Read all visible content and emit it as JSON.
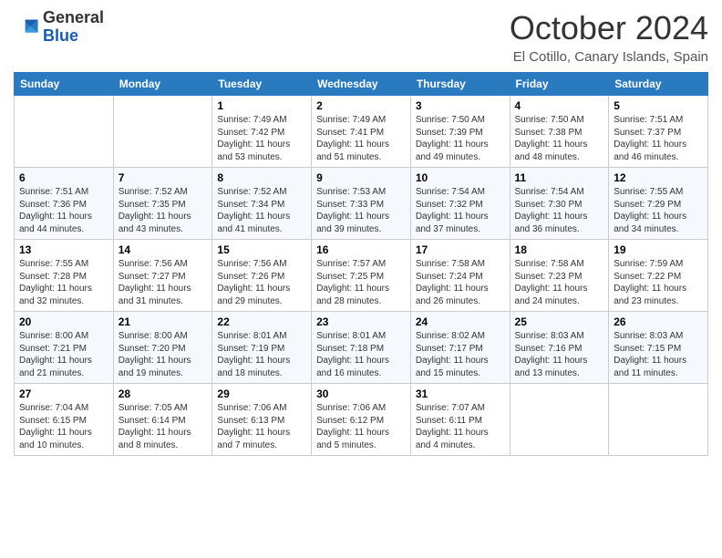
{
  "header": {
    "logo_general": "General",
    "logo_blue": "Blue",
    "month_title": "October 2024",
    "location": "El Cotillo, Canary Islands, Spain"
  },
  "days_of_week": [
    "Sunday",
    "Monday",
    "Tuesday",
    "Wednesday",
    "Thursday",
    "Friday",
    "Saturday"
  ],
  "weeks": [
    [
      {
        "day": "",
        "info": ""
      },
      {
        "day": "",
        "info": ""
      },
      {
        "day": "1",
        "info": "Sunrise: 7:49 AM\nSunset: 7:42 PM\nDaylight: 11 hours and 53 minutes."
      },
      {
        "day": "2",
        "info": "Sunrise: 7:49 AM\nSunset: 7:41 PM\nDaylight: 11 hours and 51 minutes."
      },
      {
        "day": "3",
        "info": "Sunrise: 7:50 AM\nSunset: 7:39 PM\nDaylight: 11 hours and 49 minutes."
      },
      {
        "day": "4",
        "info": "Sunrise: 7:50 AM\nSunset: 7:38 PM\nDaylight: 11 hours and 48 minutes."
      },
      {
        "day": "5",
        "info": "Sunrise: 7:51 AM\nSunset: 7:37 PM\nDaylight: 11 hours and 46 minutes."
      }
    ],
    [
      {
        "day": "6",
        "info": "Sunrise: 7:51 AM\nSunset: 7:36 PM\nDaylight: 11 hours and 44 minutes."
      },
      {
        "day": "7",
        "info": "Sunrise: 7:52 AM\nSunset: 7:35 PM\nDaylight: 11 hours and 43 minutes."
      },
      {
        "day": "8",
        "info": "Sunrise: 7:52 AM\nSunset: 7:34 PM\nDaylight: 11 hours and 41 minutes."
      },
      {
        "day": "9",
        "info": "Sunrise: 7:53 AM\nSunset: 7:33 PM\nDaylight: 11 hours and 39 minutes."
      },
      {
        "day": "10",
        "info": "Sunrise: 7:54 AM\nSunset: 7:32 PM\nDaylight: 11 hours and 37 minutes."
      },
      {
        "day": "11",
        "info": "Sunrise: 7:54 AM\nSunset: 7:30 PM\nDaylight: 11 hours and 36 minutes."
      },
      {
        "day": "12",
        "info": "Sunrise: 7:55 AM\nSunset: 7:29 PM\nDaylight: 11 hours and 34 minutes."
      }
    ],
    [
      {
        "day": "13",
        "info": "Sunrise: 7:55 AM\nSunset: 7:28 PM\nDaylight: 11 hours and 32 minutes."
      },
      {
        "day": "14",
        "info": "Sunrise: 7:56 AM\nSunset: 7:27 PM\nDaylight: 11 hours and 31 minutes."
      },
      {
        "day": "15",
        "info": "Sunrise: 7:56 AM\nSunset: 7:26 PM\nDaylight: 11 hours and 29 minutes."
      },
      {
        "day": "16",
        "info": "Sunrise: 7:57 AM\nSunset: 7:25 PM\nDaylight: 11 hours and 28 minutes."
      },
      {
        "day": "17",
        "info": "Sunrise: 7:58 AM\nSunset: 7:24 PM\nDaylight: 11 hours and 26 minutes."
      },
      {
        "day": "18",
        "info": "Sunrise: 7:58 AM\nSunset: 7:23 PM\nDaylight: 11 hours and 24 minutes."
      },
      {
        "day": "19",
        "info": "Sunrise: 7:59 AM\nSunset: 7:22 PM\nDaylight: 11 hours and 23 minutes."
      }
    ],
    [
      {
        "day": "20",
        "info": "Sunrise: 8:00 AM\nSunset: 7:21 PM\nDaylight: 11 hours and 21 minutes."
      },
      {
        "day": "21",
        "info": "Sunrise: 8:00 AM\nSunset: 7:20 PM\nDaylight: 11 hours and 19 minutes."
      },
      {
        "day": "22",
        "info": "Sunrise: 8:01 AM\nSunset: 7:19 PM\nDaylight: 11 hours and 18 minutes."
      },
      {
        "day": "23",
        "info": "Sunrise: 8:01 AM\nSunset: 7:18 PM\nDaylight: 11 hours and 16 minutes."
      },
      {
        "day": "24",
        "info": "Sunrise: 8:02 AM\nSunset: 7:17 PM\nDaylight: 11 hours and 15 minutes."
      },
      {
        "day": "25",
        "info": "Sunrise: 8:03 AM\nSunset: 7:16 PM\nDaylight: 11 hours and 13 minutes."
      },
      {
        "day": "26",
        "info": "Sunrise: 8:03 AM\nSunset: 7:15 PM\nDaylight: 11 hours and 11 minutes."
      }
    ],
    [
      {
        "day": "27",
        "info": "Sunrise: 7:04 AM\nSunset: 6:15 PM\nDaylight: 11 hours and 10 minutes."
      },
      {
        "day": "28",
        "info": "Sunrise: 7:05 AM\nSunset: 6:14 PM\nDaylight: 11 hours and 8 minutes."
      },
      {
        "day": "29",
        "info": "Sunrise: 7:06 AM\nSunset: 6:13 PM\nDaylight: 11 hours and 7 minutes."
      },
      {
        "day": "30",
        "info": "Sunrise: 7:06 AM\nSunset: 6:12 PM\nDaylight: 11 hours and 5 minutes."
      },
      {
        "day": "31",
        "info": "Sunrise: 7:07 AM\nSunset: 6:11 PM\nDaylight: 11 hours and 4 minutes."
      },
      {
        "day": "",
        "info": ""
      },
      {
        "day": "",
        "info": ""
      }
    ]
  ]
}
